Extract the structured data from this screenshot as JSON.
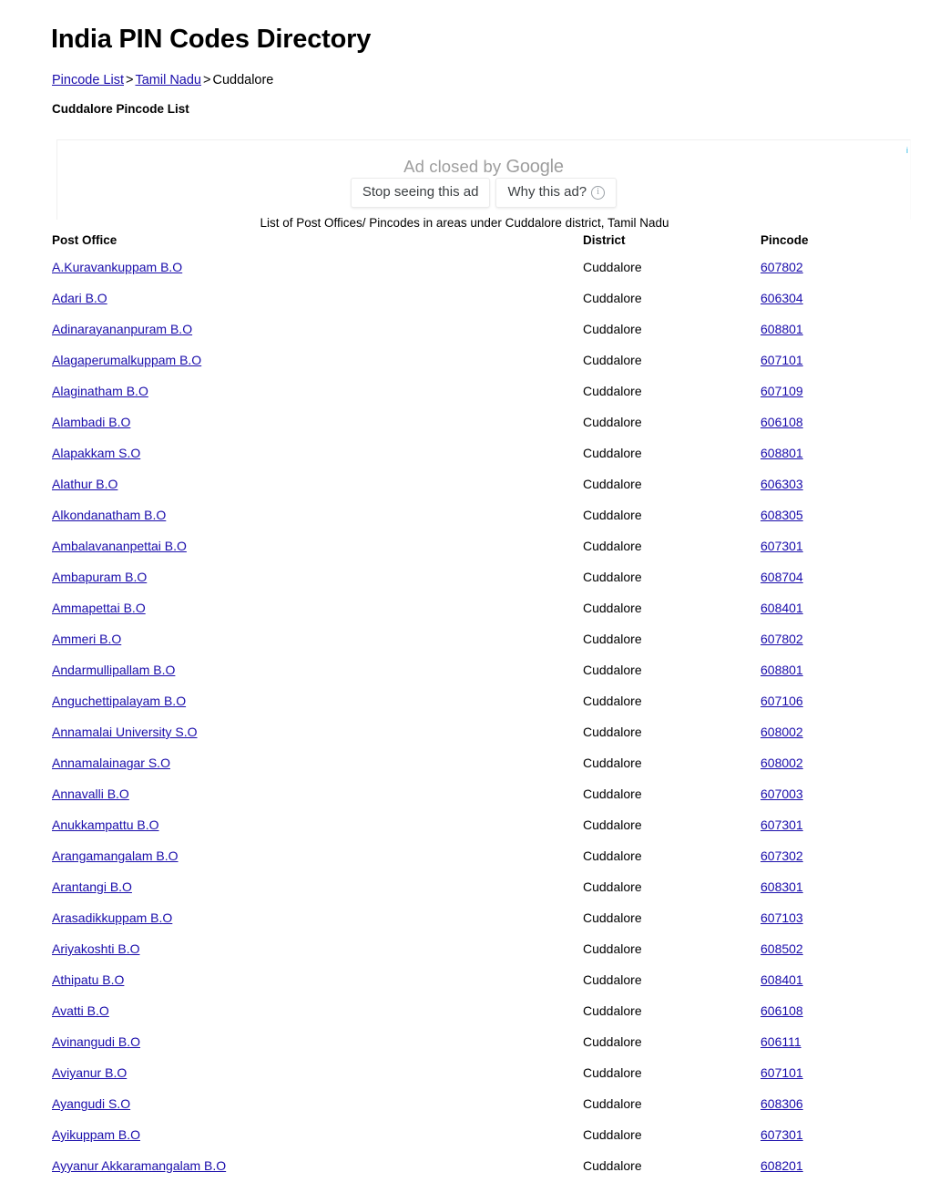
{
  "header": {
    "title": "India PIN Codes Directory"
  },
  "breadcrumb": {
    "items": [
      {
        "label": "Pincode List",
        "link": true
      },
      {
        "label": "Tamil Nadu",
        "link": true
      },
      {
        "label": "Cuddalore",
        "link": false
      }
    ],
    "separator": ">"
  },
  "section": {
    "title": "Cuddalore Pincode List"
  },
  "ad": {
    "closed_text_prefix": "Ad closed by ",
    "brand": "Google",
    "stop_button": "Stop seeing this ad",
    "why_button": "Why this ad?",
    "info_icon": "info-icon",
    "corner_info_icon": "i"
  },
  "list": {
    "caption": "List of Post Offices/ Pincodes in areas under Cuddalore district, Tamil Nadu",
    "columns": [
      "Post Office",
      "District",
      "Pincode"
    ],
    "rows": [
      {
        "office": "A.Kuravankuppam B.O",
        "district": "Cuddalore",
        "pincode": "607802"
      },
      {
        "office": "Adari B.O",
        "district": "Cuddalore",
        "pincode": "606304"
      },
      {
        "office": "Adinarayananpuram B.O",
        "district": "Cuddalore",
        "pincode": "608801"
      },
      {
        "office": "Alagaperumalkuppam B.O",
        "district": "Cuddalore",
        "pincode": "607101"
      },
      {
        "office": "Alaginatham B.O",
        "district": "Cuddalore",
        "pincode": "607109"
      },
      {
        "office": "Alambadi B.O",
        "district": "Cuddalore",
        "pincode": "606108"
      },
      {
        "office": "Alapakkam S.O",
        "district": "Cuddalore",
        "pincode": "608801"
      },
      {
        "office": "Alathur B.O",
        "district": "Cuddalore",
        "pincode": "606303"
      },
      {
        "office": "Alkondanatham B.O",
        "district": "Cuddalore",
        "pincode": "608305"
      },
      {
        "office": "Ambalavananpettai B.O",
        "district": "Cuddalore",
        "pincode": "607301"
      },
      {
        "office": "Ambapuram B.O",
        "district": "Cuddalore",
        "pincode": "608704"
      },
      {
        "office": "Ammapettai B.O",
        "district": "Cuddalore",
        "pincode": "608401"
      },
      {
        "office": "Ammeri B.O",
        "district": "Cuddalore",
        "pincode": "607802"
      },
      {
        "office": "Andarmullipallam B.O",
        "district": "Cuddalore",
        "pincode": "608801"
      },
      {
        "office": "Anguchettipalayam B.O",
        "district": "Cuddalore",
        "pincode": "607106"
      },
      {
        "office": "Annamalai University S.O",
        "district": "Cuddalore",
        "pincode": "608002"
      },
      {
        "office": "Annamalainagar S.O",
        "district": "Cuddalore",
        "pincode": "608002"
      },
      {
        "office": "Annavalli B.O",
        "district": "Cuddalore",
        "pincode": "607003"
      },
      {
        "office": "Anukkampattu B.O",
        "district": "Cuddalore",
        "pincode": "607301"
      },
      {
        "office": "Arangamangalam B.O",
        "district": "Cuddalore",
        "pincode": "607302"
      },
      {
        "office": "Arantangi B.O",
        "district": "Cuddalore",
        "pincode": "608301"
      },
      {
        "office": "Arasadikkuppam B.O",
        "district": "Cuddalore",
        "pincode": "607103"
      },
      {
        "office": "Ariyakoshti B.O",
        "district": "Cuddalore",
        "pincode": "608502"
      },
      {
        "office": "Athipatu B.O",
        "district": "Cuddalore",
        "pincode": "608401"
      },
      {
        "office": "Avatti B.O",
        "district": "Cuddalore",
        "pincode": "606108"
      },
      {
        "office": "Avinangudi B.O",
        "district": "Cuddalore",
        "pincode": "606111"
      },
      {
        "office": "Aviyanur B.O",
        "district": "Cuddalore",
        "pincode": "607101"
      },
      {
        "office": "Ayangudi S.O",
        "district": "Cuddalore",
        "pincode": "608306"
      },
      {
        "office": "Ayikuppam B.O",
        "district": "Cuddalore",
        "pincode": "607301"
      },
      {
        "office": "Ayyanur Akkaramangalam B.O",
        "district": "Cuddalore",
        "pincode": "608201"
      }
    ]
  },
  "colors": {
    "link": "#1a0dab",
    "text": "#000000",
    "ad_text": "#9e9e9e",
    "ad_info": "#2bb8e6",
    "background": "#ffffff"
  }
}
